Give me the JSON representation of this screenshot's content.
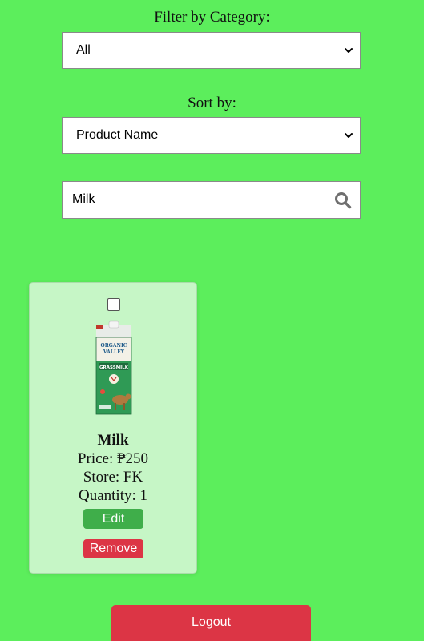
{
  "filter": {
    "label": "Filter by Category:",
    "selected": "All"
  },
  "sort": {
    "label": "Sort by:",
    "selected": "Product Name"
  },
  "search": {
    "value": "Milk"
  },
  "product": {
    "name": "Milk",
    "price": "Price: ₱250",
    "store": "Store: FK",
    "quantity": "Quantity: 1",
    "image_text": {
      "brand_line1": "ORGANIC",
      "brand_line2": "VALLEY",
      "product": "GRASSMILK"
    },
    "edit_label": "Edit",
    "remove_label": "Remove",
    "checked": false
  },
  "logout_label": "Logout",
  "colors": {
    "background": "#5cee5c",
    "card": "#c6f6c6",
    "edit": "#3fae4a",
    "danger": "#dc3545"
  },
  "icons": {
    "search": "search-icon",
    "dropdown": "chevron-down-icon"
  }
}
